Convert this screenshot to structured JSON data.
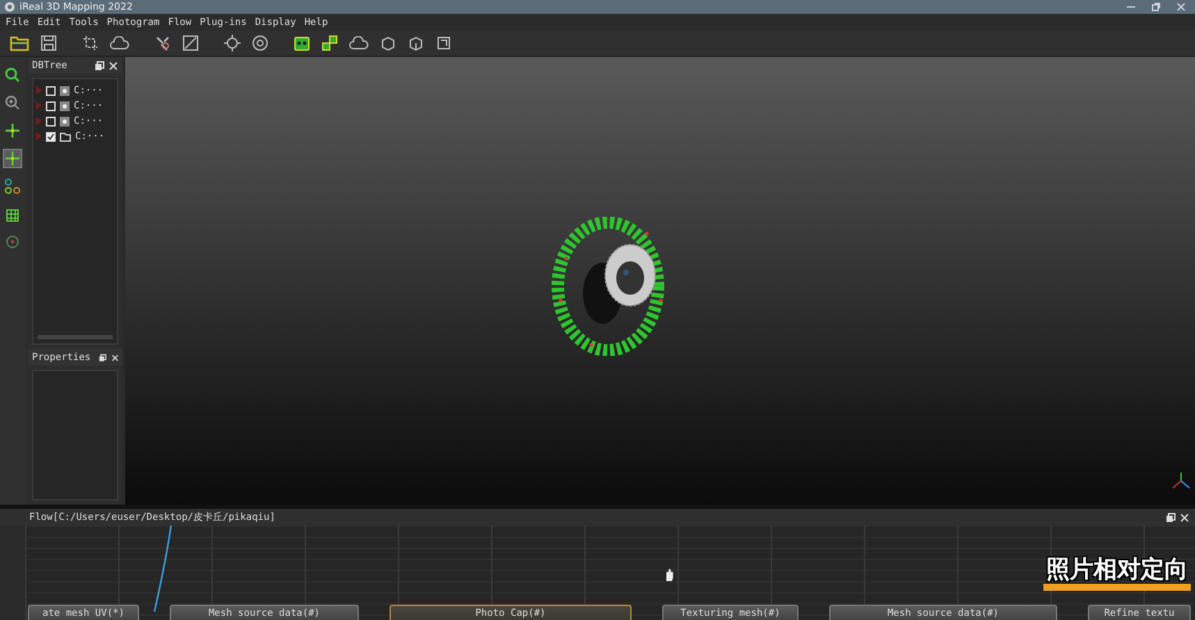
{
  "window": {
    "title": "iReal 3D Mapping 2022"
  },
  "menu": [
    "File",
    "Edit",
    "Tools",
    "Photogram",
    "Flow",
    "Plug-ins",
    "Display",
    "Help"
  ],
  "left_tools": [
    {
      "kind": "search",
      "selected": false
    },
    {
      "kind": "zoom",
      "selected": false
    },
    {
      "kind": "cross",
      "selected": false
    },
    {
      "kind": "cross",
      "selected": true
    },
    {
      "kind": "nodes",
      "selected": false
    },
    {
      "kind": "grid",
      "selected": false
    },
    {
      "kind": "target",
      "selected": false
    }
  ],
  "dbtree": {
    "title": "DBTree",
    "items": [
      {
        "label": "C:···",
        "checked": false,
        "kind": "cloud"
      },
      {
        "label": "C:···",
        "checked": false,
        "kind": "cloud"
      },
      {
        "label": "C:···",
        "checked": false,
        "kind": "cloud"
      },
      {
        "label": "C:···",
        "checked": true,
        "kind": "folder"
      }
    ]
  },
  "properties": {
    "title": "Properties"
  },
  "flow": {
    "title": "Flow[C:/Users/euser/Desktop/皮卡丘/pikaqiu]",
    "nodes": [
      {
        "label": "ate mesh UV(*)",
        "selected": false
      },
      {
        "label": "Mesh source data(#)",
        "selected": false
      },
      {
        "label": "Photo Cap(#)",
        "selected": true
      },
      {
        "label": "Texturing mesh(#)",
        "selected": false
      },
      {
        "label": "Mesh source data(#)",
        "selected": false
      },
      {
        "label": "Refine textu",
        "selected": false
      }
    ]
  },
  "caption": "照片相对定向"
}
